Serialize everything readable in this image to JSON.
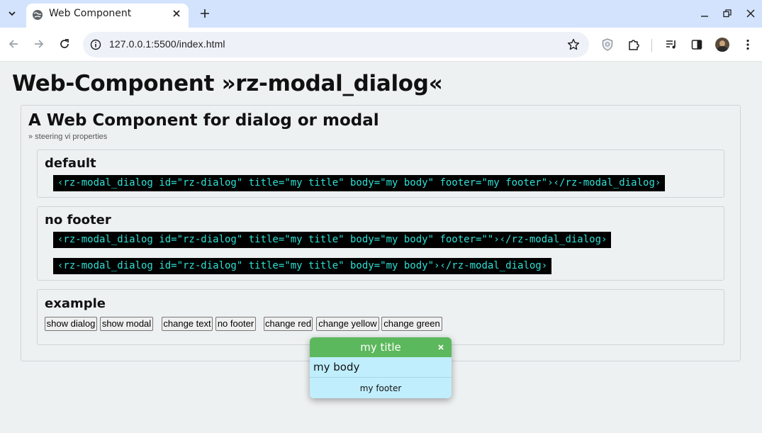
{
  "browser": {
    "tab_title": "Web Component",
    "url": "127.0.0.1:5500/index.html",
    "tab_search_icon": "chevron-down-icon",
    "colors": {
      "tabbar": "#d3e3fd",
      "omnibox": "#eef1f8"
    }
  },
  "page": {
    "title": "Web-Component »rz-modal_dialog«",
    "subtitle_heading": "A Web Component for dialog or modal",
    "subtitle_note": "» steering vi properties",
    "sections": [
      {
        "heading": "default",
        "code": [
          "‹rz-modal_dialog id=\"rz-dialog\" title=\"my title\" body=\"my body\" footer=\"my footer\"›‹/rz-modal_dialog›"
        ]
      },
      {
        "heading": "no footer",
        "code": [
          "‹rz-modal_dialog id=\"rz-dialog\" title=\"my title\" body=\"my body\" footer=\"\"›‹/rz-modal_dialog›",
          "‹rz-modal_dialog id=\"rz-dialog\" title=\"my title\" body=\"my body\"›‹/rz-modal_dialog›"
        ]
      },
      {
        "heading": "example",
        "buttons": [
          "show dialog",
          "show modal",
          "change text",
          "no footer",
          "change red",
          "change yellow",
          "change green"
        ]
      }
    ]
  },
  "dialog": {
    "title": "my title",
    "close": "×",
    "body": "my body",
    "footer": "my footer",
    "colors": {
      "header": "#5cb85c",
      "body": "#c0eefc"
    }
  },
  "code_colors": {
    "background": "#000000",
    "text": "#2ee0d4"
  }
}
